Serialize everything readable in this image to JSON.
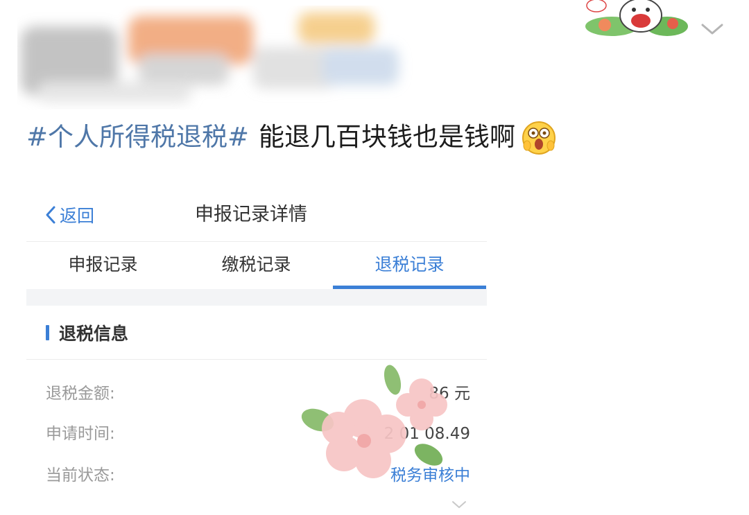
{
  "post": {
    "hashtag": "#个人所得税退税#",
    "body": "能退几百块钱也是钱啊"
  },
  "icons": {
    "emoji": "astonished-emoji-icon",
    "collapse": "chevron-down-icon",
    "back": "chevron-left-icon"
  },
  "app": {
    "back_label": "返回",
    "title": "申报记录详情",
    "tabs": [
      {
        "label": "申报记录",
        "active": false
      },
      {
        "label": "缴税记录",
        "active": false
      },
      {
        "label": "退税记录",
        "active": true
      }
    ],
    "section_title": "退税信息",
    "rows": [
      {
        "label": "退税金额:",
        "value": "86  元"
      },
      {
        "label": "申请时间:",
        "value": "2       01 08.49"
      },
      {
        "label": "当前状态:",
        "value": "税务审核中"
      }
    ]
  },
  "colors": {
    "accent": "#3b7fd6",
    "hashtag": "#4f77a8",
    "text": "#1c1c1c",
    "label": "#9a9a9a"
  }
}
